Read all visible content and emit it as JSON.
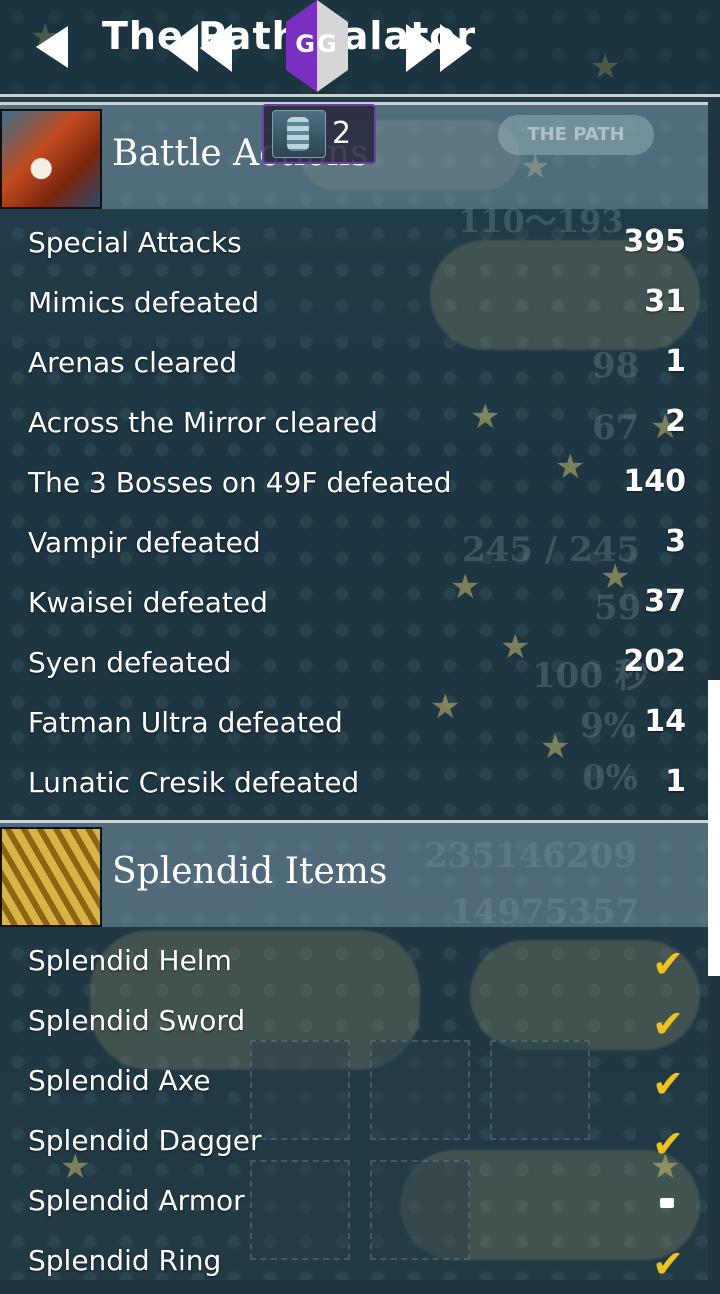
{
  "header": {
    "title": "The Path Calator",
    "back_icon": "back-arrow-icon",
    "overlay_badge": "GG",
    "overlay_counter": "2"
  },
  "sections": [
    {
      "title": "Battle Actions",
      "badge": "THE PATH",
      "rows": [
        {
          "label": "Special Attacks",
          "value": "395"
        },
        {
          "label": "Mimics defeated",
          "value": "31"
        },
        {
          "label": "Arenas cleared",
          "value": "1"
        },
        {
          "label": "Across the Mirror cleared",
          "value": "2"
        },
        {
          "label": "The 3 Bosses on 49F defeated",
          "value": "140"
        },
        {
          "label": "Vampir defeated",
          "value": "3"
        },
        {
          "label": "Kwaisei defeated",
          "value": "37"
        },
        {
          "label": "Syen defeated",
          "value": "202"
        },
        {
          "label": "Fatman Ultra defeated",
          "value": "14"
        },
        {
          "label": "Lunatic Cresik defeated",
          "value": "1"
        }
      ]
    },
    {
      "title": "Splendid Items",
      "rows": [
        {
          "label": "Splendid Helm",
          "status": "check"
        },
        {
          "label": "Splendid Sword",
          "status": "check"
        },
        {
          "label": "Splendid Axe",
          "status": "check"
        },
        {
          "label": "Splendid Dagger",
          "status": "check"
        },
        {
          "label": "Splendid Armor",
          "status": "dash"
        },
        {
          "label": "Splendid Ring",
          "status": "check"
        }
      ]
    }
  ],
  "background_text": [
    "110～193",
    "245 / 245",
    "100 秒",
    "9%",
    "0%",
    "235146209",
    "14975357",
    "98",
    "67",
    "59"
  ],
  "colors": {
    "accent_check": "#f1c21b",
    "gg_purple": "#7a2fc0",
    "header_band": "#7896a5"
  }
}
